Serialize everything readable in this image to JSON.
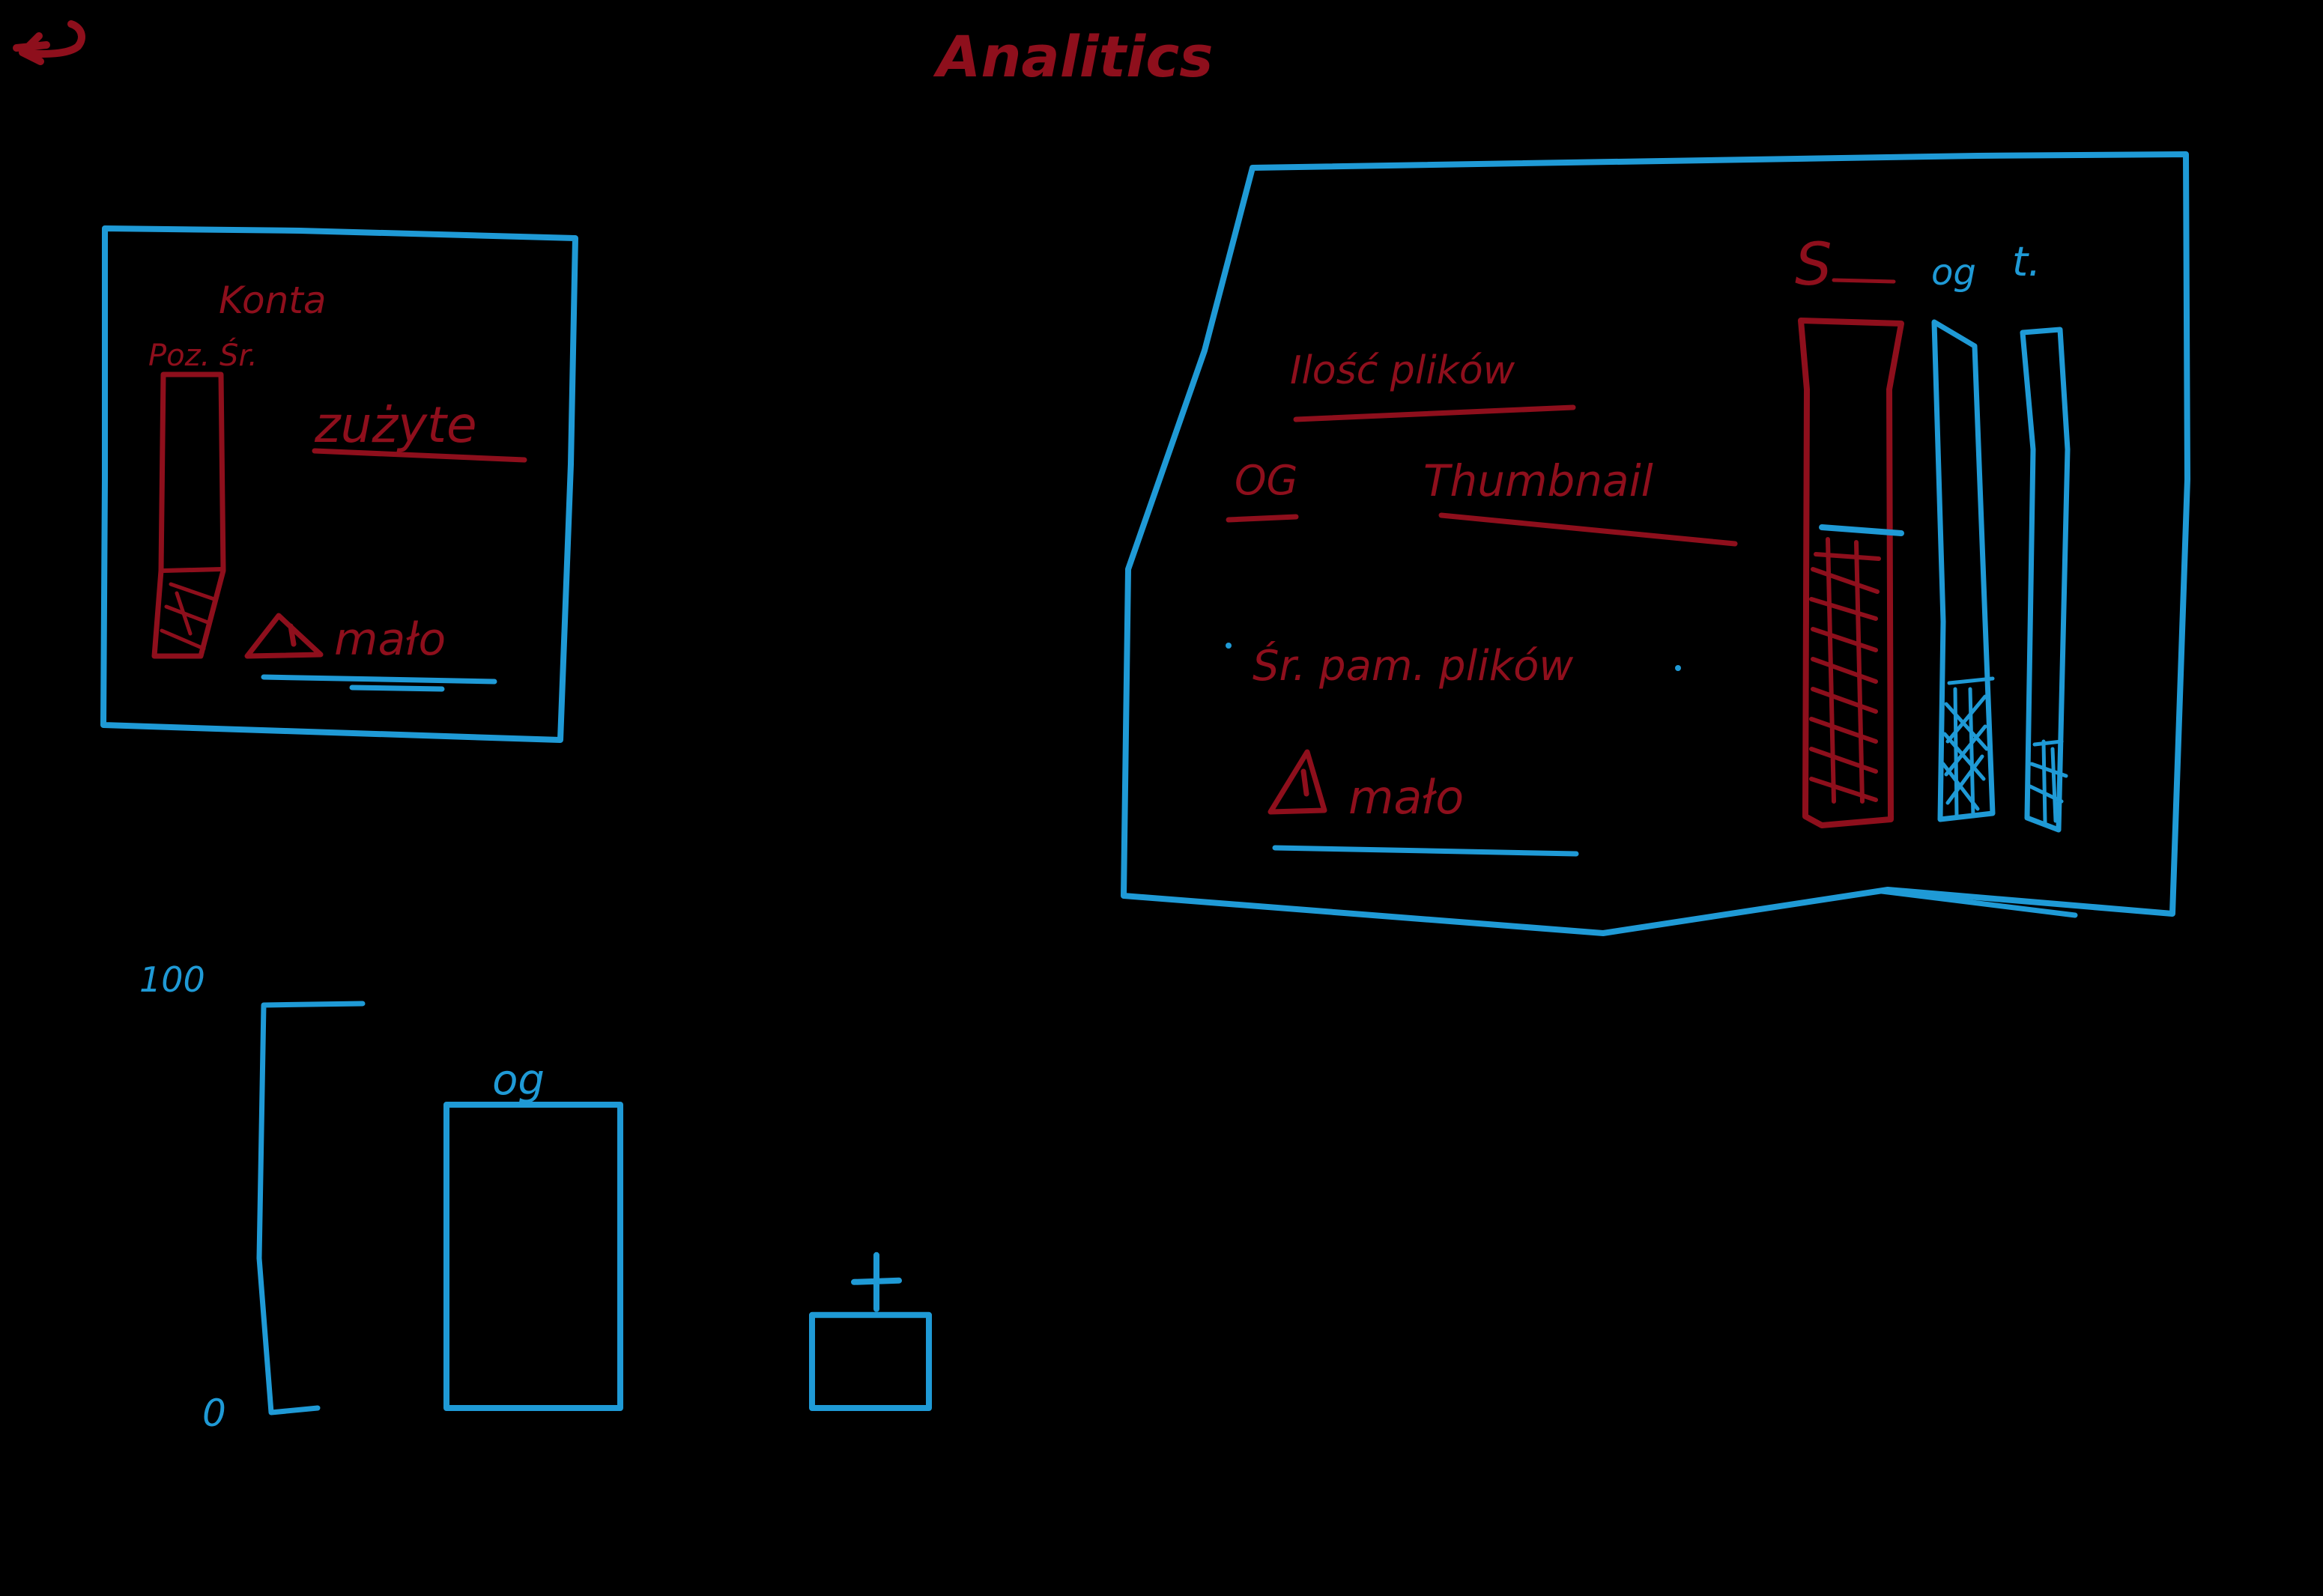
{
  "header": {
    "title": "Analitics",
    "back_icon": "back-arrow-icon"
  },
  "colors": {
    "background": "#000000",
    "red": "#8e0f1c",
    "blue": "#1f9ad6"
  },
  "accounts_panel": {
    "title": "Konta",
    "bar_label": "Poz. Śr.",
    "used_label": "zużyte",
    "warning_text": "mało",
    "warning_icon": "warning-icon"
  },
  "files_panel": {
    "title": "Ilość plików",
    "col_og": "OG",
    "col_thumbnail": "Thumbnail",
    "avg_label": "Śr. pam. plików",
    "warning_text": "mało",
    "warning_icon": "warning-icon",
    "bar_labels": [
      "S",
      "og",
      "t."
    ]
  },
  "chart_data": {
    "type": "bar",
    "categories": [
      "og",
      "t"
    ],
    "values": [
      75,
      23
    ],
    "ylim": [
      0,
      100
    ],
    "y_tick_labels": [
      "100",
      "0"
    ]
  }
}
